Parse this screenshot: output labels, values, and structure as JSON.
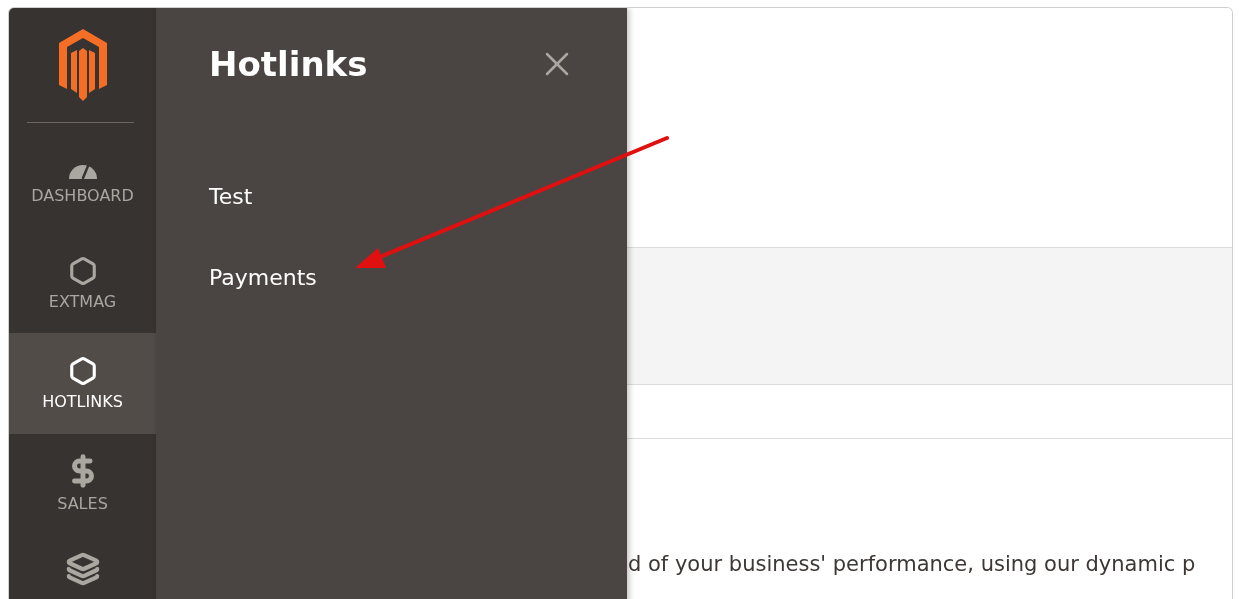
{
  "sidebar": {
    "items": [
      {
        "label": "DASHBOARD",
        "kind": "gauge",
        "selected": false
      },
      {
        "label": "EXTMAG",
        "kind": "hexagon",
        "selected": false
      },
      {
        "label": "HOTLINKS",
        "kind": "hexagon",
        "selected": true
      },
      {
        "label": "SALES",
        "kind": "dollar",
        "selected": false
      }
    ]
  },
  "flyout": {
    "title": "Hotlinks",
    "items": [
      {
        "label": "Test"
      },
      {
        "label": "Payments"
      }
    ]
  },
  "content": {
    "text": "d of your business' performance, using our dynamic p"
  }
}
